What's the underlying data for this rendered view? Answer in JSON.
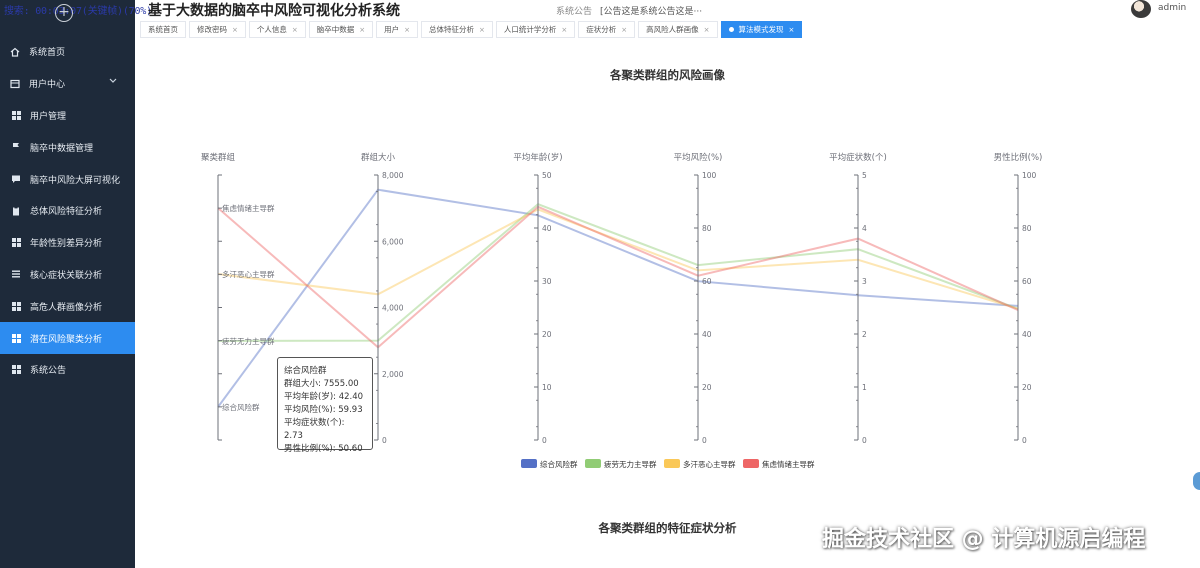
{
  "header": {
    "search_overlay": "搜索: 00:03:07(关键帧)(70%)",
    "app_title": "基于大数据的脑卒中风险可视化分析系统",
    "notice_label": "系统公告",
    "notice_text": "[公告这是系统公告这是···",
    "user_name": "admin"
  },
  "sidebar": {
    "items": [
      {
        "label": "系统首页",
        "icon": "home-icon"
      },
      {
        "label": "用户中心",
        "icon": "square-icon"
      },
      {
        "label": "用户管理",
        "icon": "grid-icon"
      },
      {
        "label": "脑卒中数据管理",
        "icon": "flag-icon"
      },
      {
        "label": "脑卒中风险大屏可视化",
        "icon": "comment-icon"
      },
      {
        "label": "总体风险特征分析",
        "icon": "clipboard-icon"
      },
      {
        "label": "年龄性别差异分析",
        "icon": "grid-icon"
      },
      {
        "label": "核心症状关联分析",
        "icon": "list-icon"
      },
      {
        "label": "高危人群画像分析",
        "icon": "grid-icon"
      },
      {
        "label": "潜在风险聚类分析",
        "icon": "grid-icon"
      },
      {
        "label": "系统公告",
        "icon": "grid-icon"
      }
    ],
    "active_index": 9,
    "expanded_index": 1
  },
  "tabs": [
    {
      "label": "系统首页"
    },
    {
      "label": "修改密码"
    },
    {
      "label": "个人信息"
    },
    {
      "label": "脑卒中数据"
    },
    {
      "label": "用户"
    },
    {
      "label": "总体特征分析"
    },
    {
      "label": "人口统计学分析"
    },
    {
      "label": "症状分析"
    },
    {
      "label": "高风险人群画像"
    },
    {
      "label": "算法模式发现",
      "active": true
    }
  ],
  "chart_title": "各聚类群组的风险画像",
  "chart2_title": "各聚类群组的特征症状分析",
  "chart_data": {
    "type": "parallel",
    "dimensions": [
      {
        "name": "聚类群组",
        "type": "category",
        "categories": [
          "综合风险群",
          "疲劳无力主导群",
          "多汗恶心主导群",
          "焦虑情绪主导群"
        ]
      },
      {
        "name": "群组大小",
        "min": 0,
        "max": 8000,
        "ticks": [
          "0",
          "2,000",
          "4,000",
          "6,000",
          "8,000"
        ]
      },
      {
        "name": "平均年龄(岁)",
        "min": 0,
        "max": 50,
        "ticks": [
          "0",
          "10",
          "20",
          "30",
          "40",
          "50"
        ]
      },
      {
        "name": "平均风险(%)",
        "min": 0,
        "max": 100,
        "ticks": [
          "0",
          "20",
          "40",
          "60",
          "80",
          "100"
        ]
      },
      {
        "name": "平均症状数(个)",
        "min": 0,
        "max": 5,
        "ticks": [
          "0",
          "1",
          "2",
          "3",
          "4",
          "5"
        ]
      },
      {
        "name": "男性比例(%)",
        "min": 0,
        "max": 100,
        "ticks": [
          "0",
          "20",
          "40",
          "60",
          "80",
          "100"
        ]
      }
    ],
    "series": [
      {
        "name": "综合风险群",
        "color": "#5470c6",
        "values": [
          "综合风险群",
          7555.0,
          42.4,
          59.93,
          2.73,
          50.6
        ]
      },
      {
        "name": "疲劳无力主导群",
        "color": "#91cc75",
        "values": [
          "疲劳无力主导群",
          3000,
          44.5,
          66,
          3.6,
          49.5
        ]
      },
      {
        "name": "多汗恶心主导群",
        "color": "#fac858",
        "values": [
          "多汗恶心主导群",
          4400,
          43.5,
          64,
          3.4,
          49.5
        ]
      },
      {
        "name": "焦虑情绪主导群",
        "color": "#ee6666",
        "values": [
          "焦虑情绪主导群",
          2800,
          44.0,
          62,
          3.8,
          49.0
        ]
      }
    ],
    "legend_position": "bottom-center",
    "tooltip": {
      "title": "综合风险群",
      "lines": [
        "群组大小: 7555.00",
        "平均年龄(岁): 42.40",
        "平均风险(%): 59.93",
        "平均症状数(个): 2.73",
        "男性比例(%): 50.60"
      ]
    }
  },
  "watermark": "掘金技术社区 @ 计算机源启编程"
}
